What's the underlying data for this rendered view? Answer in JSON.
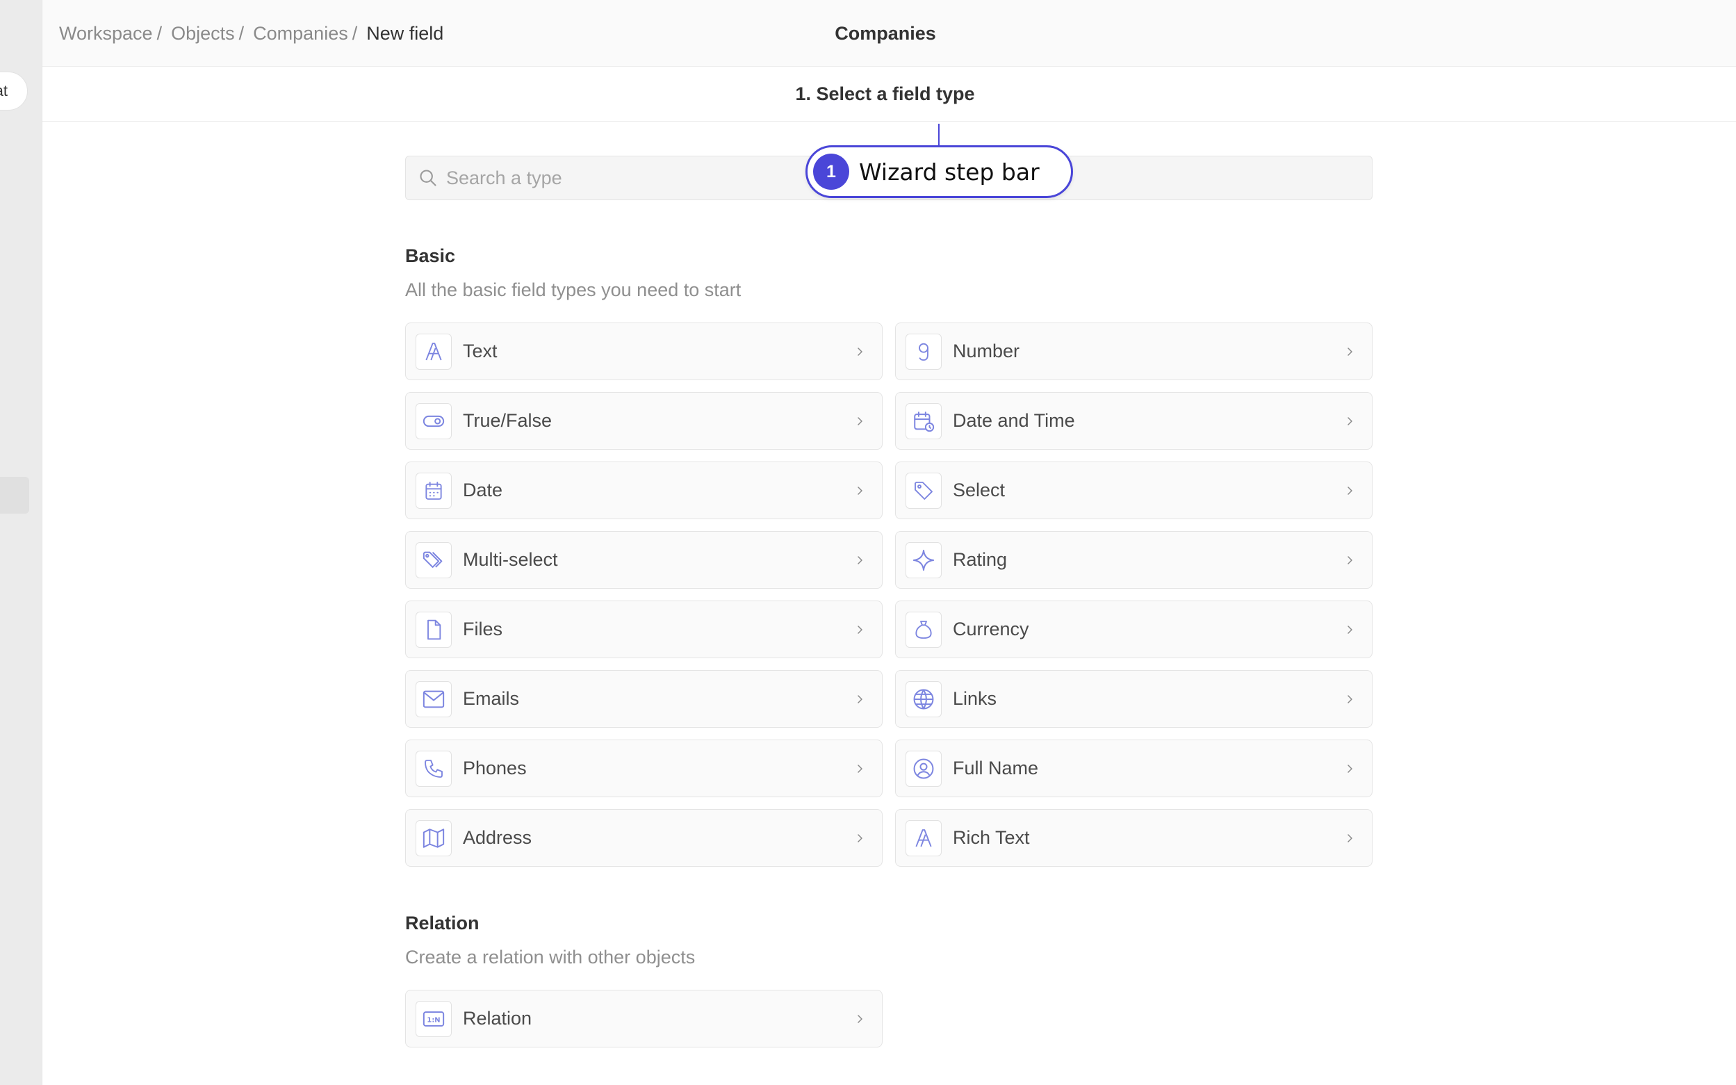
{
  "sidebar": {
    "pill_label": "at"
  },
  "breadcrumb": {
    "items": [
      "Workspace",
      "Objects",
      "Companies"
    ],
    "separator": "/",
    "current": "New field"
  },
  "header": {
    "title": "Companies"
  },
  "wizard": {
    "step_label": "1. Select a field type"
  },
  "search": {
    "placeholder": "Search a type",
    "value": ""
  },
  "basic": {
    "title": "Basic",
    "description": "All the basic field types you need to start",
    "types": [
      {
        "label": "Text",
        "icon": "text-icon"
      },
      {
        "label": "Number",
        "icon": "number-icon"
      },
      {
        "label": "True/False",
        "icon": "toggle-icon"
      },
      {
        "label": "Date and Time",
        "icon": "calendar-clock-icon"
      },
      {
        "label": "Date",
        "icon": "calendar-icon"
      },
      {
        "label": "Select",
        "icon": "tag-icon"
      },
      {
        "label": "Multi-select",
        "icon": "tags-icon"
      },
      {
        "label": "Rating",
        "icon": "sparkle-icon"
      },
      {
        "label": "Files",
        "icon": "file-icon"
      },
      {
        "label": "Currency",
        "icon": "money-bag-icon"
      },
      {
        "label": "Emails",
        "icon": "mail-icon"
      },
      {
        "label": "Links",
        "icon": "world-icon"
      },
      {
        "label": "Phones",
        "icon": "phone-icon"
      },
      {
        "label": "Full Name",
        "icon": "user-circle-icon"
      },
      {
        "label": "Address",
        "icon": "map-icon"
      },
      {
        "label": "Rich Text",
        "icon": "text-icon"
      }
    ]
  },
  "relation": {
    "title": "Relation",
    "description": "Create a relation with other objects",
    "types": [
      {
        "label": "Relation",
        "icon": "relation-icon"
      }
    ]
  },
  "callout": {
    "number": "1",
    "text": "Wizard step bar"
  },
  "colors": {
    "icon": "#7c85e0",
    "accent": "#4a46d8",
    "card_bg": "#fafafa",
    "border": "#e4e4e4"
  }
}
